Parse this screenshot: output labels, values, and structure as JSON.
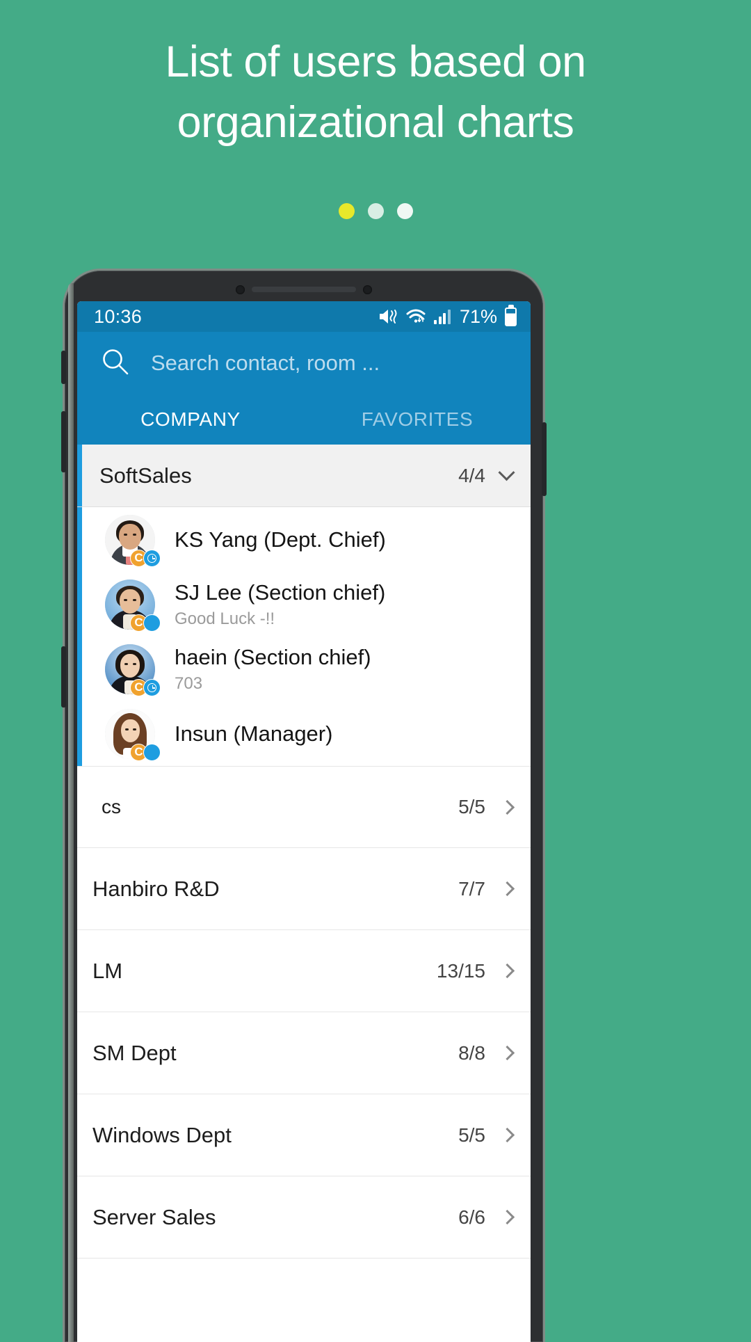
{
  "promo": {
    "headline": "List of users based on organizational charts",
    "dots": [
      {
        "state": "active"
      },
      {
        "state": "inactive"
      },
      {
        "state": "inactive"
      }
    ],
    "background_color": "#44ab87",
    "active_dot_color": "#e8e82a"
  },
  "statusbar": {
    "time": "10:36",
    "battery_percent": "71%",
    "icons": [
      "mute-icon",
      "wifi-icon",
      "signal-icon",
      "battery-icon"
    ]
  },
  "appbar": {
    "search_placeholder": "Search contact, room ...",
    "search_value": "",
    "accent_color": "#1184bd",
    "tabs": [
      {
        "label": "COMPANY",
        "active": true
      },
      {
        "label": "FAVORITES",
        "active": false
      }
    ]
  },
  "group": {
    "name": "SoftSales",
    "count": "4/4",
    "expanded": true,
    "accent_color": "#1e9de0"
  },
  "contacts": [
    {
      "name": "KS Yang (Dept. Chief)",
      "status_message": "",
      "presence": "away",
      "badge": "C"
    },
    {
      "name": "SJ Lee (Section chief)",
      "status_message": "Good Luck -!!",
      "presence": "online",
      "badge": "C"
    },
    {
      "name": "haein (Section chief)",
      "status_message": "703",
      "presence": "away",
      "badge": "C"
    },
    {
      "name": "Insun (Manager)",
      "status_message": "",
      "presence": "online",
      "badge": "C"
    }
  ],
  "departments": [
    {
      "name": "cs",
      "count": "5/5",
      "indent": true
    },
    {
      "name": "Hanbiro R&D",
      "count": "7/7",
      "indent": false
    },
    {
      "name": "LM",
      "count": "13/15",
      "indent": false
    },
    {
      "name": "SM Dept",
      "count": "8/8",
      "indent": false
    },
    {
      "name": "Windows Dept",
      "count": "5/5",
      "indent": false
    },
    {
      "name": "Server Sales",
      "count": "6/6",
      "indent": false
    }
  ]
}
